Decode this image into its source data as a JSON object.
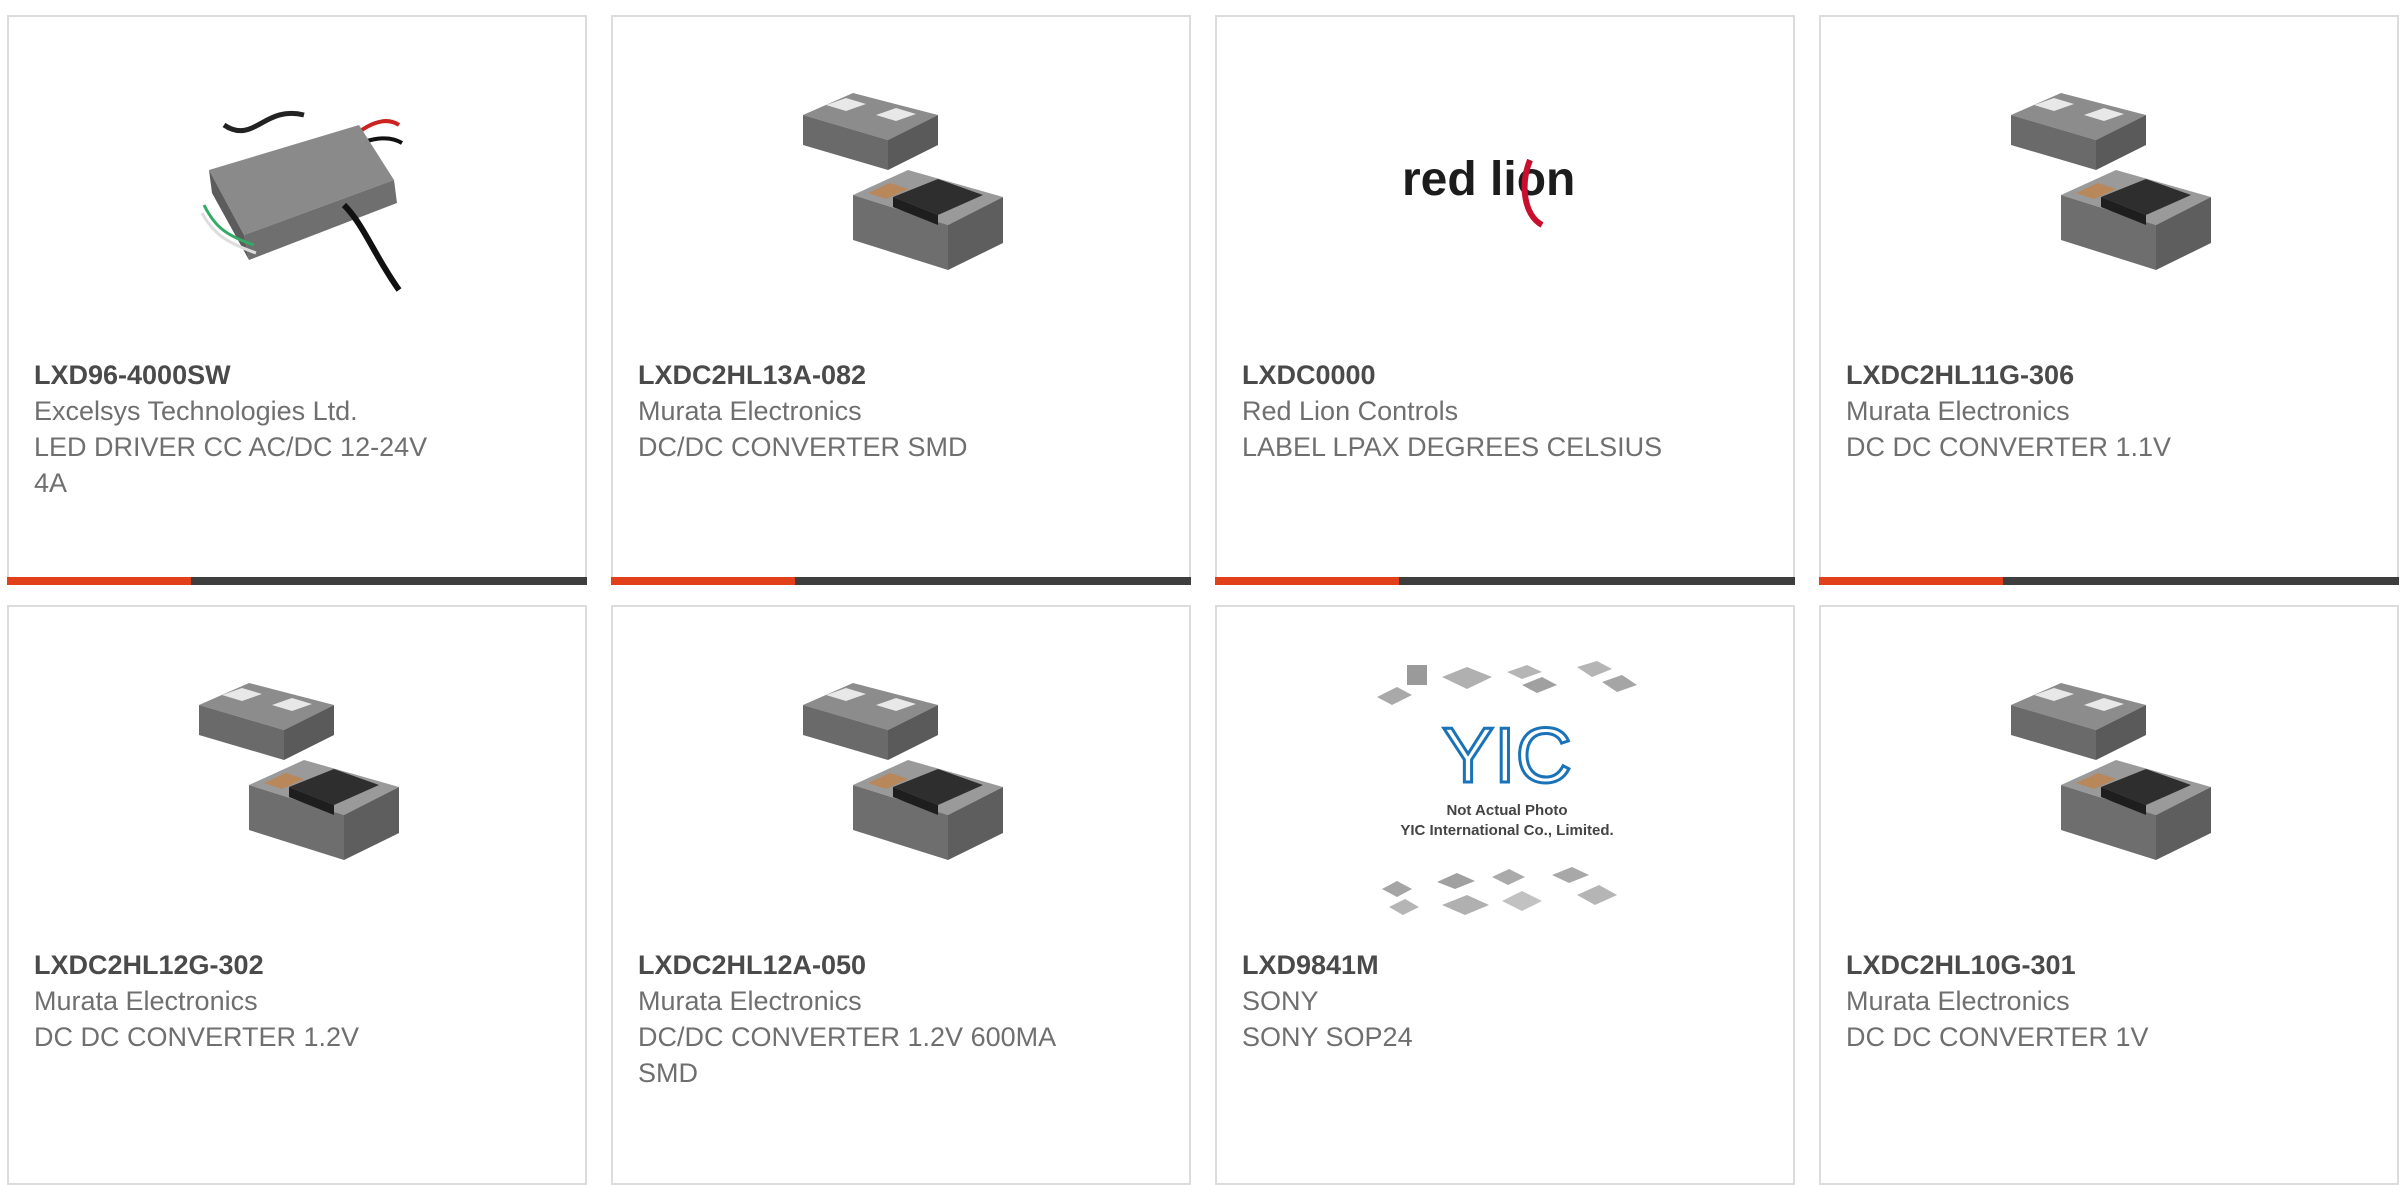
{
  "accent_color": "#e2401b",
  "bar_color": "#3e3e3e",
  "products": [
    {
      "part": "LXD96-4000SW",
      "manufacturer": "Excelsys Technologies Ltd.",
      "description": "LED DRIVER CC AC/DC 12-24V 4A",
      "image": "led-driver-image"
    },
    {
      "part": "LXDC2HL13A-082",
      "manufacturer": "Murata Electronics",
      "description": "DC/DC CONVERTER SMD",
      "image": "smd-module-image"
    },
    {
      "part": "LXDC0000",
      "manufacturer": "Red Lion Controls",
      "description": "LABEL LPAX DEGREES CELSIUS",
      "image": "red-lion-logo",
      "logo_text": "red lion"
    },
    {
      "part": "LXDC2HL11G-306",
      "manufacturer": "Murata Electronics",
      "description": "DC DC CONVERTER 1.1V",
      "image": "smd-module-image"
    },
    {
      "part": "LXDC2HL12G-302",
      "manufacturer": "Murata Electronics",
      "description": "DC DC CONVERTER 1.2V",
      "image": "smd-module-image"
    },
    {
      "part": "LXDC2HL12A-050",
      "manufacturer": "Murata Electronics",
      "description": "DC/DC CONVERTER 1.2V 600MA SMD",
      "image": "smd-module-image"
    },
    {
      "part": "LXD9841M",
      "manufacturer": "SONY",
      "description": "SONY SOP24",
      "image": "yic-placeholder-image",
      "logo_text": "YIC",
      "placeholder_line1": "Not Actual Photo",
      "placeholder_line2": "YIC International Co., Limited."
    },
    {
      "part": "LXDC2HL10G-301",
      "manufacturer": "Murata Electronics",
      "description": "DC DC CONVERTER 1V",
      "image": "smd-module-image"
    }
  ]
}
